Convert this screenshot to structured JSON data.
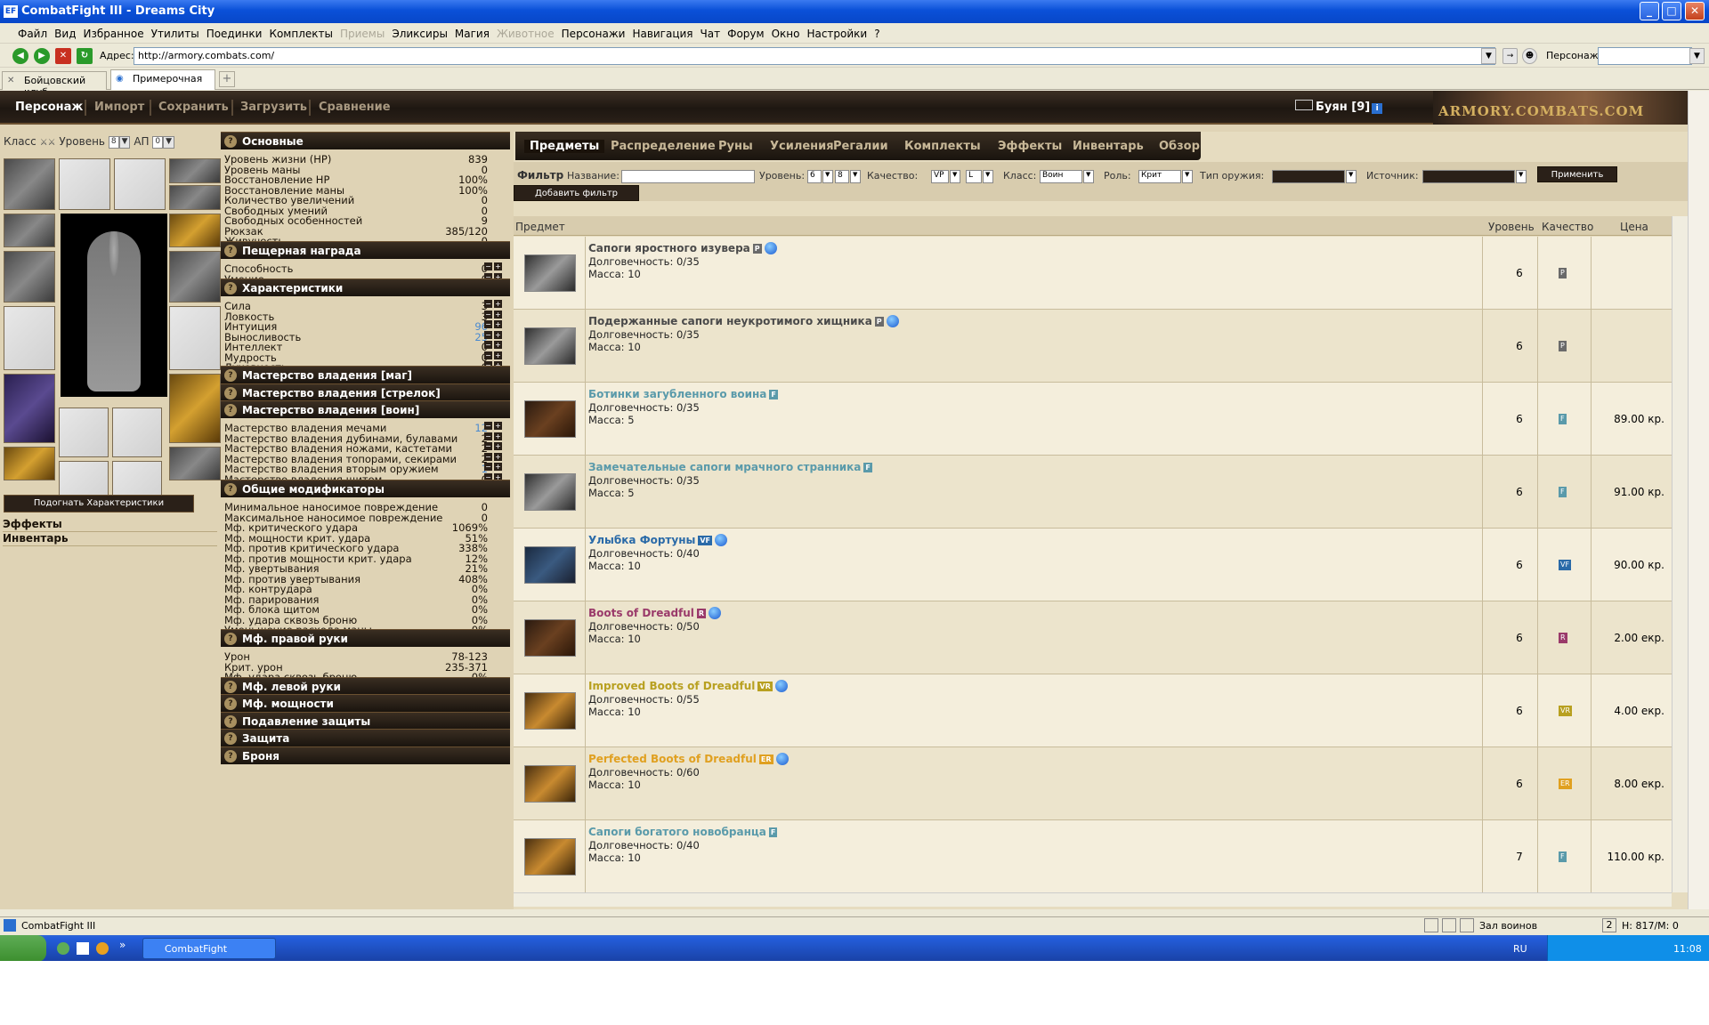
{
  "window": {
    "title": "CombatFight III - Dreams City",
    "icon": "EF",
    "min": "_",
    "max": "□",
    "close": "✕"
  },
  "menu": [
    "Файл",
    "Вид",
    "Избранное",
    "Утилиты",
    "Поединки",
    "Комплекты",
    "Приемы",
    "Эликсиры",
    "Магия",
    "Животное",
    "Персонажи",
    "Навигация",
    "Чат",
    "Форум",
    "Окно",
    "Настройки",
    "?"
  ],
  "menu_disabled": [
    "Приемы",
    "Животное"
  ],
  "address": {
    "label": "Адрес:",
    "value": "http://armory.combats.com/",
    "persona_label": "Персонаж:"
  },
  "browser_tabs": [
    {
      "label": "Бойцовский клуб"
    },
    {
      "label": "Примерочная"
    }
  ],
  "topnav": [
    "Персонаж",
    "Импорт",
    "Сохранить",
    "Загрузить",
    "Сравнение"
  ],
  "user": {
    "name": "Буян",
    "level": "[9]",
    "info": "i"
  },
  "banner": "ARMORY.COMBATS.COM",
  "left": {
    "class_label": "Класс",
    "level_label": "Уровень",
    "level_value": "8",
    "ap_label": "АП",
    "ap_value": "0",
    "fit_button": "Подогнать Характеристики",
    "effects": "Эффекты",
    "inventory": "Инвентарь"
  },
  "stats": {
    "basic": {
      "title": "Основные",
      "rows": [
        {
          "k": "Уровень жизни (HP)",
          "v": "839"
        },
        {
          "k": "Уровень маны",
          "v": "0"
        },
        {
          "k": "Восстановление HP",
          "v": "100%"
        },
        {
          "k": "Восстановление маны",
          "v": "100%"
        },
        {
          "k": "Количество увеличений",
          "v": "0"
        },
        {
          "k": "Свободных умений",
          "v": "0"
        },
        {
          "k": "Свободных особенностей",
          "v": "9"
        },
        {
          "k": "Рюкзак",
          "v": "385/120"
        },
        {
          "k": "Живучесть",
          "v": "0"
        }
      ]
    },
    "cave": {
      "title": "Пещерная награда",
      "rows": [
        {
          "k": "Способность",
          "v": "0"
        },
        {
          "k": "Умение",
          "v": "0"
        }
      ]
    },
    "chars": {
      "title": "Характеристики",
      "rows": [
        {
          "k": "Сила",
          "v": "3"
        },
        {
          "k": "Ловкость",
          "v": "3"
        },
        {
          "k": "Интуиция",
          "v": "96",
          "blue": true
        },
        {
          "k": "Выносливость",
          "v": "25",
          "blue": true
        },
        {
          "k": "Интеллект",
          "v": "0"
        },
        {
          "k": "Мудрость",
          "v": "0"
        },
        {
          "k": "Духовность",
          "v": "0"
        }
      ]
    },
    "mage": {
      "title": "Мастерство владения [маг]"
    },
    "archer": {
      "title": "Мастерство владения [стрелок]"
    },
    "warrior": {
      "title": "Мастерство владения [воин]",
      "rows": [
        {
          "k": "Мастерство владения мечами",
          "v": "12",
          "blue": true
        },
        {
          "k": "Мастерство владения дубинами, булавами",
          "v": "2"
        },
        {
          "k": "Мастерство владения ножами, кастетами",
          "v": "2"
        },
        {
          "k": "Мастерство владения топорами, секирами",
          "v": "2"
        },
        {
          "k": "Мастерство владения вторым оружием",
          "v": "1",
          "blue": true
        },
        {
          "k": "Мастерство владения щитом",
          "v": "0"
        }
      ]
    },
    "mods": {
      "title": "Общие модификаторы",
      "rows": [
        {
          "k": "Минимальное наносимое повреждение",
          "v": "0"
        },
        {
          "k": "Максимальное наносимое повреждение",
          "v": "0"
        },
        {
          "k": "Мф. критического удара",
          "v": "1069%"
        },
        {
          "k": "Мф. мощности крит. удара",
          "v": "51%"
        },
        {
          "k": "Мф. против критического удара",
          "v": "338%"
        },
        {
          "k": "Мф. против мощности крит. удара",
          "v": "12%"
        },
        {
          "k": "Мф. увертывания",
          "v": "21%"
        },
        {
          "k": "Мф. против увертывания",
          "v": "408%"
        },
        {
          "k": "Мф. контрудара",
          "v": "0%"
        },
        {
          "k": "Мф. парирования",
          "v": "0%"
        },
        {
          "k": "Мф. блока щитом",
          "v": "0%"
        },
        {
          "k": "Мф. удара сквозь броню",
          "v": "0%"
        },
        {
          "k": "Уменьшение расхода маны",
          "v": "0%"
        }
      ]
    },
    "right": {
      "title": "Мф. правой руки",
      "rows": [
        {
          "k": "Урон",
          "v": "78-123"
        },
        {
          "k": "Крит. урон",
          "v": "235-371"
        },
        {
          "k": "Мф. удара сквозь броню",
          "v": "0%"
        }
      ]
    },
    "lefthand": {
      "title": "Мф. левой руки"
    },
    "power": {
      "title": "Мф. мощности"
    },
    "suppress": {
      "title": "Подавление защиты"
    },
    "defense": {
      "title": "Защита"
    },
    "armor": {
      "title": "Броня"
    }
  },
  "item_tabs": [
    "Предметы",
    "Распределение",
    "Руны",
    "Усиления",
    "Регалии",
    "Комплекты",
    "Эффекты",
    "Инвентарь",
    "Обзор"
  ],
  "filter": {
    "title": "Фильтр",
    "name_label": "Название:",
    "level_label": "Уровень:",
    "level_from": "6",
    "level_to": "8",
    "quality_label": "Качество:",
    "q_from": "VP",
    "q_to": "L",
    "class_label": "Класс:",
    "class_value": "Воин",
    "role_label": "Роль:",
    "role_value": "Крит",
    "weapon_label": "Тип оружия:",
    "source_label": "Источник:",
    "apply": "Применить",
    "add": "Добавить фильтр"
  },
  "table": {
    "headers": {
      "item": "Предмет",
      "level": "Уровень",
      "quality": "Качество",
      "price": "Цена"
    },
    "rows": [
      {
        "name": "Сапоги яростного изувера",
        "q": "P",
        "qcolor": "#6a6a6a",
        "namecolor": "#4a4a4a",
        "globe": true,
        "dur": "Долговечность: 0/35",
        "mass": "Масса: 10",
        "lvl": "6",
        "price": ""
      },
      {
        "name": "Подержанные сапоги неукротимого хищника",
        "q": "P",
        "qcolor": "#6a6a6a",
        "namecolor": "#4a4a4a",
        "globe": true,
        "dur": "Долговечность: 0/35",
        "mass": "Масса: 10",
        "lvl": "6",
        "price": ""
      },
      {
        "name": "Ботинки загубленного воина",
        "q": "F",
        "qcolor": "#5a9aaa",
        "namecolor": "#5a9aaa",
        "globe": false,
        "dur": "Долговечность: 0/35",
        "mass": "Масса: 5",
        "lvl": "6",
        "price": "89.00 кр."
      },
      {
        "name": "Замечательные сапоги мрачного странника",
        "q": "F",
        "qcolor": "#5a9aaa",
        "namecolor": "#5a9aaa",
        "globe": false,
        "dur": "Долговечность: 0/35",
        "mass": "Масса: 5",
        "lvl": "6",
        "price": "91.00 кр."
      },
      {
        "name": "Улыбка Фортуны",
        "q": "VF",
        "qcolor": "#2a6aa8",
        "namecolor": "#2a6aa8",
        "globe": true,
        "dur": "Долговечность: 0/40",
        "mass": "Масса: 10",
        "lvl": "6",
        "price": "90.00 кр."
      },
      {
        "name": "Boots of Dreadful",
        "q": "R",
        "qcolor": "#9a3a6a",
        "namecolor": "#9a3a6a",
        "globe": true,
        "dur": "Долговечность: 0/50",
        "mass": "Масса: 10",
        "lvl": "6",
        "price": "2.00 екр."
      },
      {
        "name": "Improved Boots of Dreadful",
        "q": "VR",
        "qcolor": "#b8a020",
        "namecolor": "#b8a020",
        "globe": true,
        "dur": "Долговечность: 0/55",
        "mass": "Масса: 10",
        "lvl": "6",
        "price": "4.00 екр."
      },
      {
        "name": "Perfected Boots of Dreadful",
        "q": "ER",
        "qcolor": "#e0a020",
        "namecolor": "#e0a020",
        "globe": true,
        "dur": "Долговечность: 0/60",
        "mass": "Масса: 10",
        "lvl": "6",
        "price": "8.00 екр."
      },
      {
        "name": "Сапоги богатого новобранца",
        "q": "F",
        "qcolor": "#5a9aaa",
        "namecolor": "#5a9aaa",
        "globe": false,
        "dur": "Долговечность: 0/40",
        "mass": "Масса: 10",
        "lvl": "7",
        "price": "110.00 кр."
      }
    ]
  },
  "status": {
    "app": "CombatFight III",
    "room": "Зал воинов",
    "hm": "H: 817/M: 0",
    "icon_count": "2"
  },
  "taskbar": {
    "button": "CombatFight",
    "lang": "RU",
    "time": "11:08"
  }
}
